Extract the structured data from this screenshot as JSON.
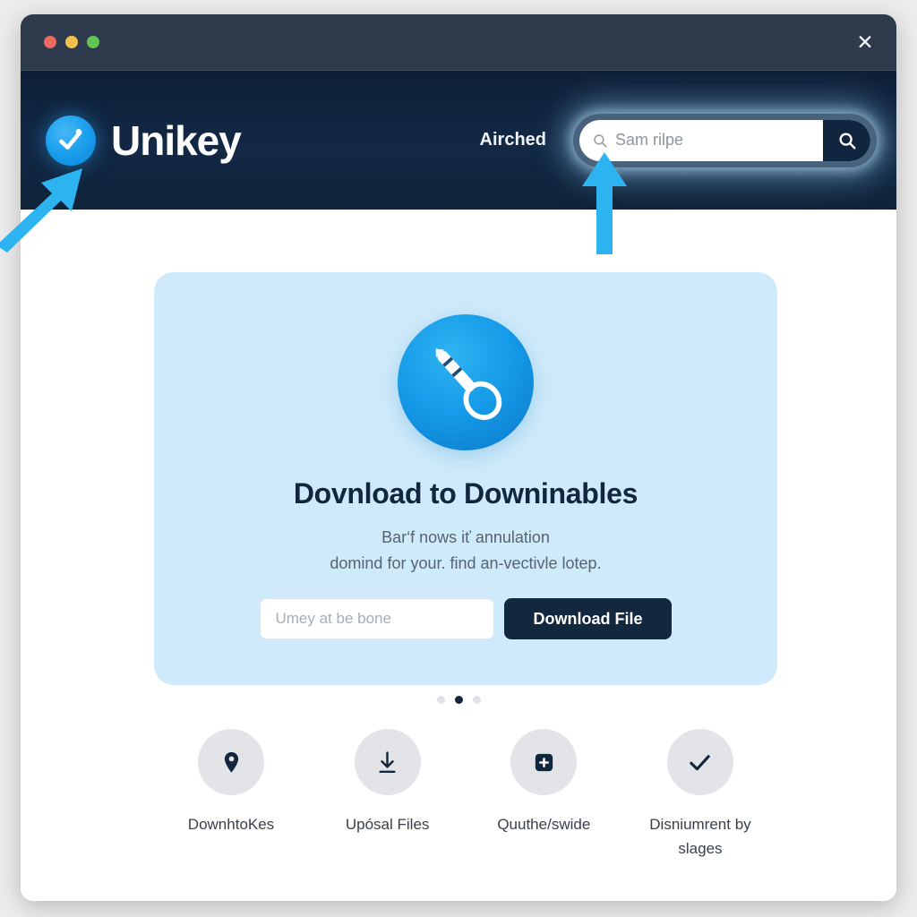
{
  "window": {
    "traffic_lights": [
      "close",
      "minimize",
      "maximize"
    ],
    "close_label": "✕",
    "colors": {
      "titlebar": "#2d3b4d",
      "header": "#122844",
      "accent_blue": "#1da1ee",
      "card": "#cfeafa",
      "dark_navy": "#12283f",
      "annotation_arrow": "#2db4f0"
    }
  },
  "header": {
    "brand_name": "Unikey",
    "brand_icon": "check-key-badge-icon",
    "nav_link": "Airched",
    "search": {
      "value": "Sam rilpe",
      "placeholder": "Sam rilpe",
      "icon": "search-icon",
      "button_icon": "search-icon"
    }
  },
  "hero": {
    "icon": "key-pen-icon",
    "title": "Dovnload to Downinables",
    "subtitle_line1": "Bar‘f nows iť annulation",
    "subtitle_line2": "domind for your. find an-vectivle lotep.",
    "input_placeholder": "Umey at be bone",
    "input_value": "",
    "button_label": "Download File"
  },
  "pagination": {
    "total": 3,
    "active_index": 1
  },
  "features": [
    {
      "label": "DownhtoKes",
      "icon": "location-pin-icon"
    },
    {
      "label": "Upósal Files",
      "icon": "download-icon"
    },
    {
      "label": "Quuthe/swide",
      "icon": "add-square-icon"
    },
    {
      "label": "Disniumrent by slages",
      "icon": "check-icon"
    }
  ],
  "annotations": [
    {
      "name": "arrow-pointing-to-logo",
      "direction": "up-right"
    },
    {
      "name": "arrow-pointing-to-search",
      "direction": "up"
    }
  ]
}
